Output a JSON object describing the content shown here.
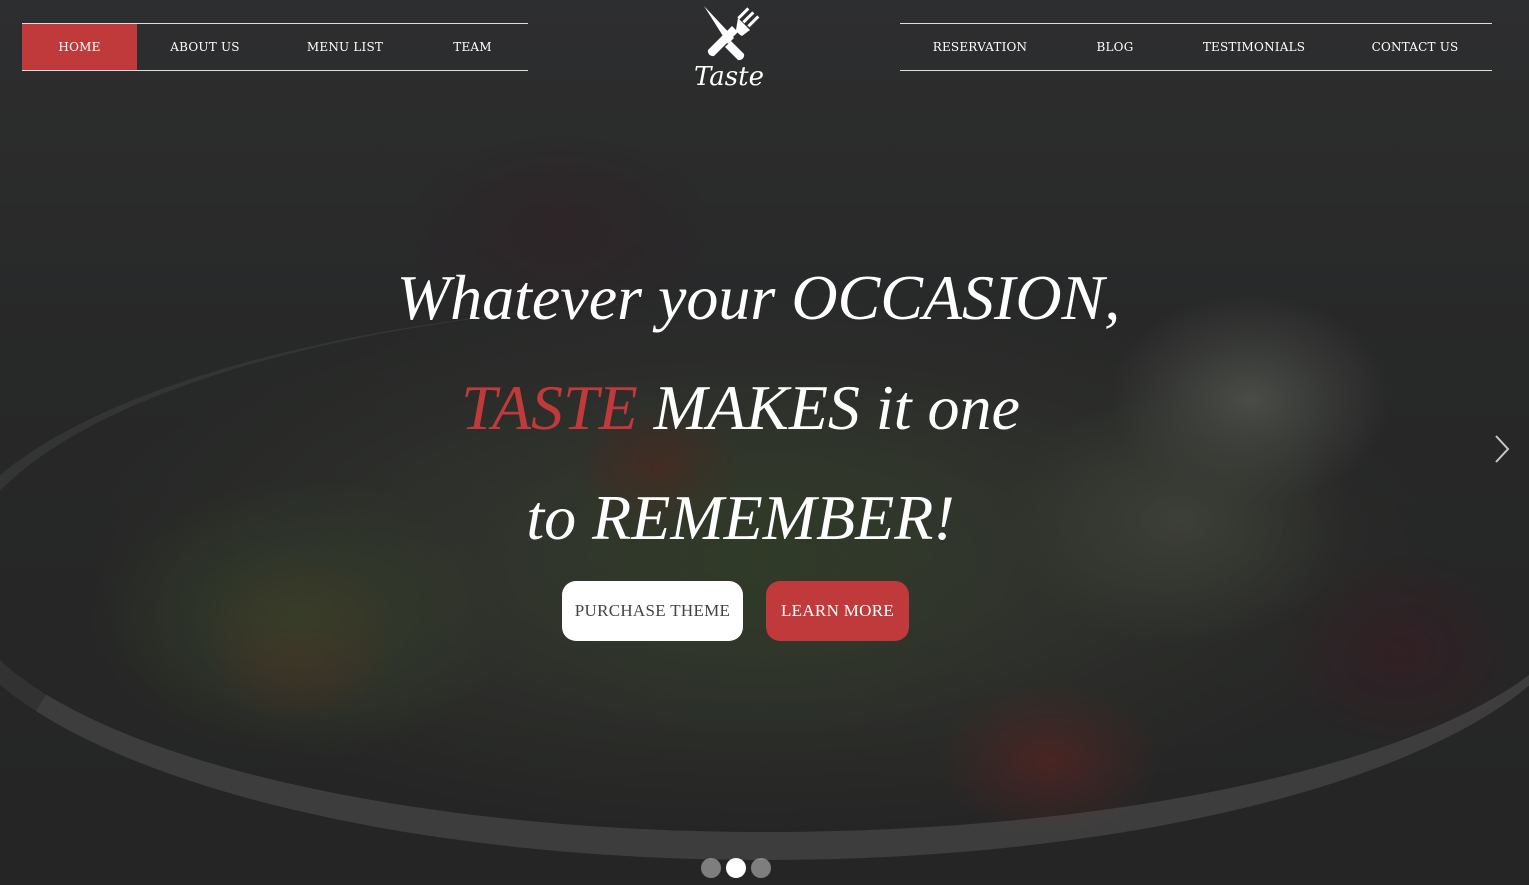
{
  "nav_left": [
    {
      "label": "HOME",
      "active": true
    },
    {
      "label": "ABOUT US",
      "active": false
    },
    {
      "label": "MENU LIST",
      "active": false
    },
    {
      "label": "TEAM",
      "active": false
    }
  ],
  "nav_right": [
    {
      "label": "RESERVATION"
    },
    {
      "label": "BLOG"
    },
    {
      "label": "TESTIMONIALS"
    },
    {
      "label": "CONTACT US"
    }
  ],
  "logo": {
    "text": "Taste",
    "icon": "crossed-fork-knife-icon"
  },
  "hero": {
    "line1": "Whatever your OCCASION,",
    "line2_accent": "TASTE",
    "line2_rest": " MAKES it one",
    "line3": "to REMEMBER!",
    "purchase_label": "PURCHASE THEME",
    "learn_label": "LEARN MORE"
  },
  "slider": {
    "slide_count": 3,
    "active_slide": 2,
    "next_icon": "chevron-right-icon"
  },
  "colors": {
    "accent": "#c0393b",
    "text": "#ffffff",
    "button_light": "#ffffff"
  }
}
